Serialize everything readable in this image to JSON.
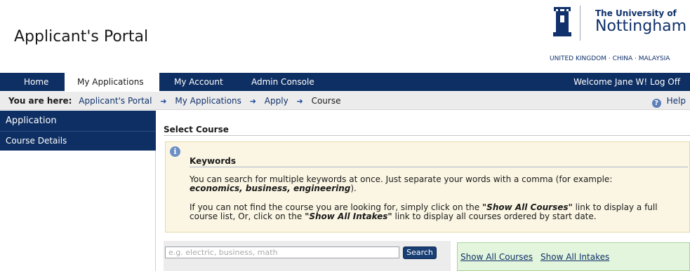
{
  "header": {
    "app_title": "Applicant's Portal",
    "logo": {
      "line1": "The University of",
      "line2": "Nottingham",
      "countries": "UNITED KINGDOM · CHINA · MALAYSIA"
    }
  },
  "nav": {
    "tabs": [
      {
        "label": "Home"
      },
      {
        "label": "My Applications",
        "active": true
      },
      {
        "label": "My Account"
      },
      {
        "label": "Admin Console"
      }
    ],
    "welcome": "Welcome Jane W! Log Off"
  },
  "breadcrumb": {
    "label": "You are here:",
    "items": [
      "Applicant's Portal",
      "My Applications",
      "Apply",
      "Course"
    ],
    "help": "Help"
  },
  "sidebar": {
    "items": [
      {
        "label": "Application"
      },
      {
        "label": "Course Details"
      }
    ]
  },
  "main": {
    "section_title": "Select Course",
    "info": {
      "heading": "Keywords",
      "p1": "You can search for multiple keywords at once. Just separate your words with a comma (for example:",
      "p1_example": "economics, business, engineering",
      "p1_end": ").",
      "p2_start": "If you can not find the course you are looking for, simply click on the",
      "p2_link1": "\"Show All Courses\"",
      "p2_mid": "link to display a full course list, Or, click on the",
      "p2_link2": "\"Show All Intakes\"",
      "p2_end": "link to display all courses ordered by start date."
    },
    "search": {
      "placeholder": "e.g. electric, business, math",
      "value": "",
      "button_label": "Search"
    },
    "links": {
      "show_all_courses": "Show All Courses",
      "show_all_intakes": "Show All Intakes"
    }
  },
  "colors": {
    "nav_bg": "#0e2f63",
    "info_bg": "#fbf6e3",
    "show_bg": "#e3f5dc",
    "brand": "#10316b"
  },
  "icons": {
    "help": "help-icon",
    "info": "info-icon",
    "breadcrumb_separator": "arrow-right-icon",
    "crest": "university-crest-icon"
  }
}
